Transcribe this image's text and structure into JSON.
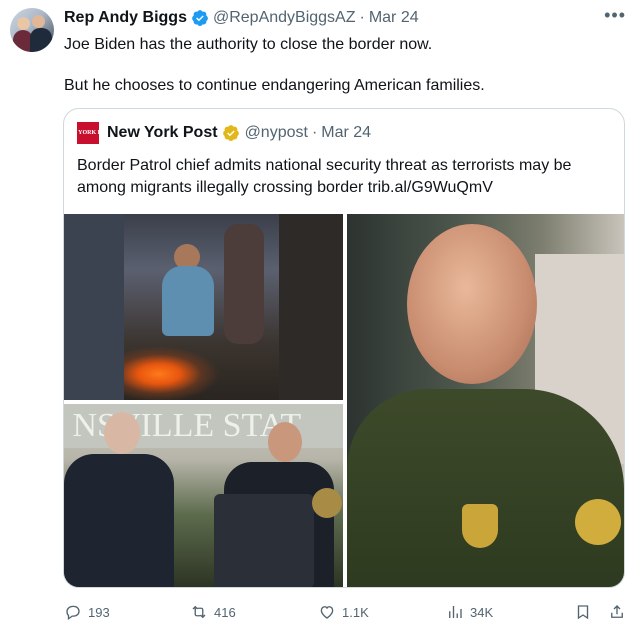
{
  "tweet": {
    "author_name": "Rep Andy Biggs",
    "handle": "@RepAndyBiggsAZ",
    "separator": "·",
    "date": "Mar 24",
    "more_icon": "more-icon",
    "line1": "Joe Biden has the authority to close the border now.",
    "line2": "But he chooses to continue endangering American families."
  },
  "quote": {
    "logo_text": "NEW YORK POST",
    "author_name": "New York Post",
    "handle": "@nypost",
    "separator": "·",
    "date": "Mar 24",
    "line1": "Border Patrol chief admits national security threat as terrorists may be",
    "line2": "among migrants illegally crossing border trib.al/G9WuQmV"
  },
  "actions": {
    "replies": "193",
    "reposts": "416",
    "likes": "1.1K",
    "views": "34K"
  },
  "colors": {
    "verified_blue": "#1d9bf0",
    "verified_gold": "#e2b719",
    "nypost_red": "#c8102e",
    "secondary_text": "#536471"
  }
}
